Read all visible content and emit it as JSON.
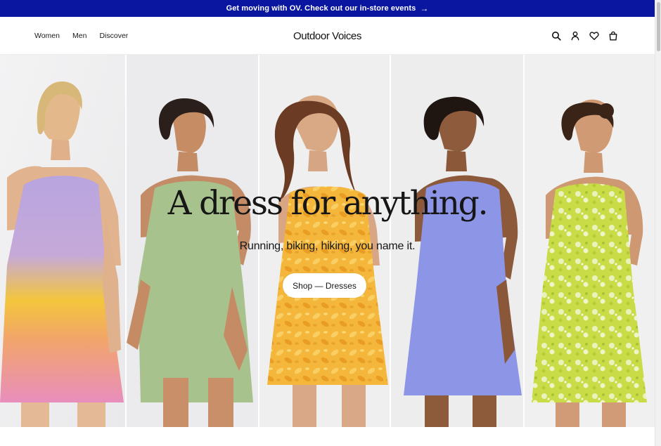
{
  "announcement": {
    "text": "Get moving with OV. Check out our in-store events",
    "arrow": "→"
  },
  "nav": {
    "left": [
      "Women",
      "Men",
      "Discover"
    ],
    "logo": "Outdoor Voices",
    "icons": [
      "search-icon",
      "account-icon",
      "wishlist-heart-icon",
      "cart-bag-icon"
    ]
  },
  "hero": {
    "headline": "A dress for anything.",
    "subheadline": "Running, biking, hiking, you name it.",
    "cta_label": "Shop — Dresses",
    "panels": [
      {
        "dress": "lavender-to-pink ombre",
        "colors": [
          "#b8a3de",
          "#f2c63e",
          "#e98fb6"
        ]
      },
      {
        "dress": "sage green",
        "colors": [
          "#a9c28e"
        ]
      },
      {
        "dress": "yellow leaf print",
        "colors": [
          "#f2b53a"
        ]
      },
      {
        "dress": "periwinkle",
        "colors": [
          "#8c95e6"
        ]
      },
      {
        "dress": "lime floral",
        "colors": [
          "#c7da4a"
        ]
      }
    ]
  },
  "colors": {
    "announcement_bg": "#0a16a0",
    "text": "#161616",
    "background": "#ffffff"
  }
}
